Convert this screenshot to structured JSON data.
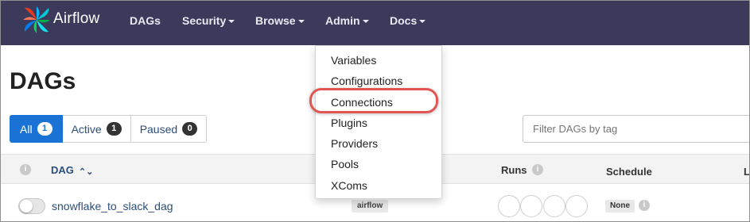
{
  "navbar": {
    "brand": "Airflow",
    "items": [
      {
        "label": "DAGs",
        "dropdown": false
      },
      {
        "label": "Security",
        "dropdown": true
      },
      {
        "label": "Browse",
        "dropdown": true
      },
      {
        "label": "Admin",
        "dropdown": true
      },
      {
        "label": "Docs",
        "dropdown": true
      }
    ]
  },
  "page": {
    "title": "DAGs"
  },
  "filters": {
    "all": {
      "label": "All",
      "count": "1"
    },
    "active": {
      "label": "Active",
      "count": "1"
    },
    "paused": {
      "label": "Paused",
      "count": "0"
    }
  },
  "tag_filter": {
    "placeholder": "Filter DAGs by tag"
  },
  "table": {
    "headers": {
      "dag": "DAG",
      "runs": "Runs",
      "schedule": "Schedule",
      "last": "L"
    },
    "rows": [
      {
        "dag": "snowflake_to_slack_dag",
        "tag": "airflow",
        "schedule": "None",
        "paused": true
      }
    ]
  },
  "admin_menu": {
    "items": [
      "Variables",
      "Configurations",
      "Connections",
      "Plugins",
      "Providers",
      "Pools",
      "XComs"
    ],
    "highlighted": "Connections"
  },
  "colors": {
    "navbar": "#3c3a5a",
    "accent": "#1a73d4",
    "highlight": "#e25553",
    "link": "#2c4e7a"
  }
}
